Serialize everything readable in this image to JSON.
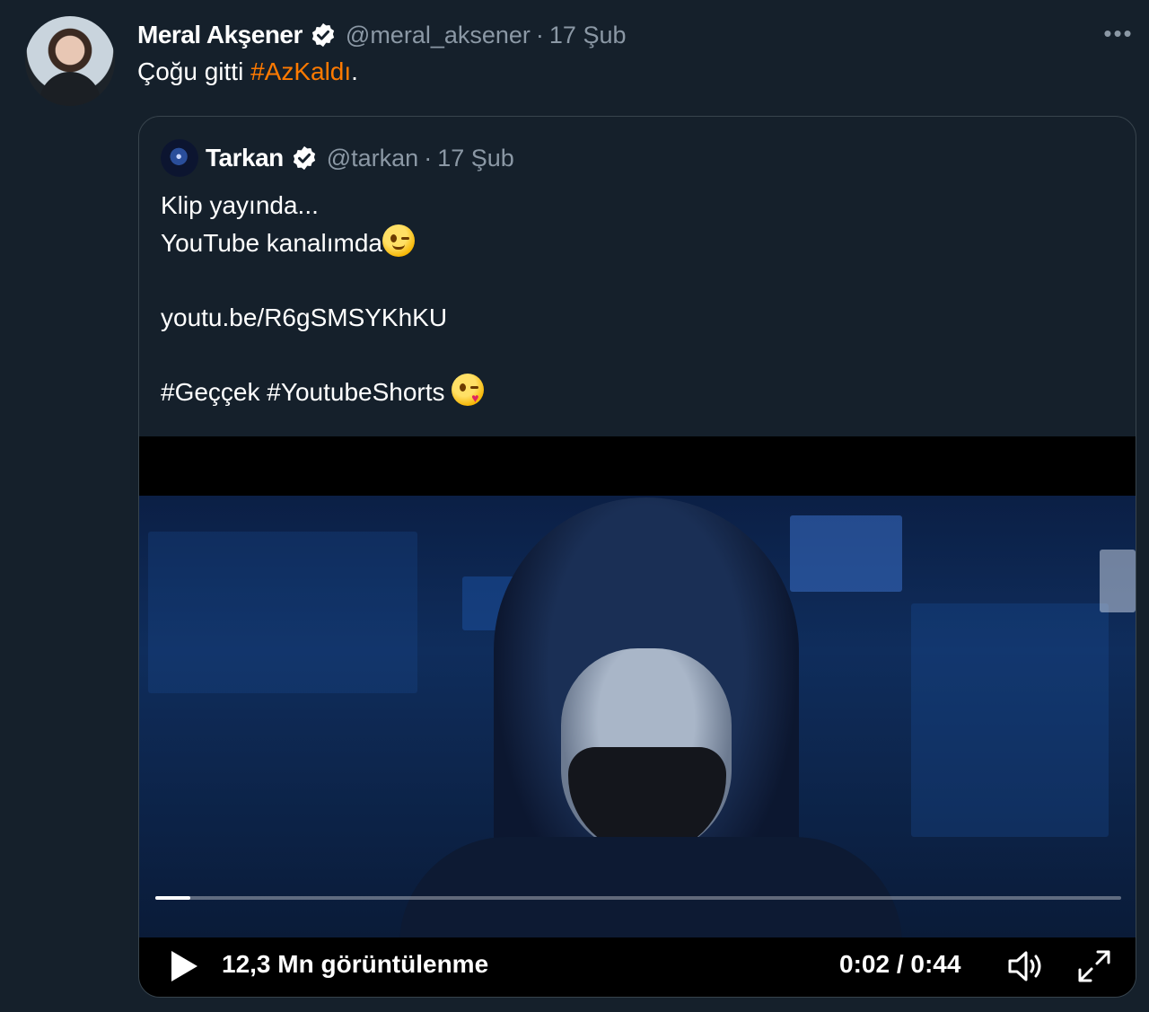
{
  "tweet": {
    "author_name": "Meral Akşener",
    "author_handle": "@meral_aksener",
    "separator": "·",
    "date": "17 Şub",
    "more_label": "•••",
    "text_plain": "Çoğu gitti ",
    "hashtag": "#AzKaldı",
    "text_suffix": "."
  },
  "quoted_tweet": {
    "author_name": "Tarkan",
    "author_handle": "@tarkan",
    "separator": "·",
    "date": "17 Şub",
    "lines": [
      "Klip yayında...",
      "YouTube kanalımda",
      "",
      "youtu.be/R6gSMSYKhKU",
      "",
      "#Geççek #YoutubeShorts "
    ]
  },
  "video": {
    "views": "12,3 Mn görüntülenme",
    "time": "0:02 / 0:44",
    "progress": 0.036
  },
  "colors": {
    "background": "#15202b",
    "hashtag": "#ff7a00",
    "muted": "#8b98a5",
    "border": "#38444d"
  },
  "icons": [
    "verified-badge-icon",
    "more-icon",
    "play-icon",
    "volume-icon",
    "fullscreen-icon",
    "winking-face-emoji",
    "kissing-face-emoji"
  ]
}
